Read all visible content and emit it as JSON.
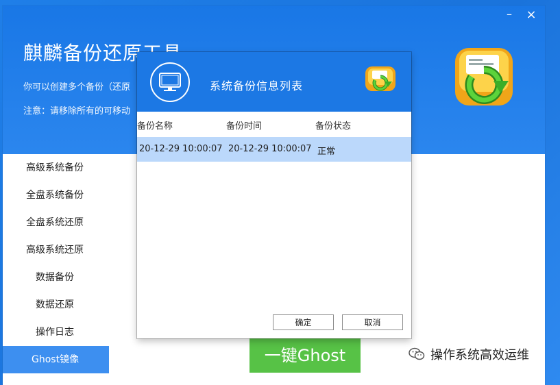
{
  "app": {
    "title": "麒麟备份还原工具",
    "desc1": "你可以创建多个备份（还原",
    "desc2": "注意：请移除所有的可移动",
    "minimize_glyph": "–",
    "close_glyph": "×"
  },
  "sidebar": {
    "items": [
      {
        "label": "高级系统备份"
      },
      {
        "label": "全盘系统备份"
      },
      {
        "label": "全盘系统还原"
      },
      {
        "label": "高级系统还原"
      },
      {
        "label": "数据备份"
      },
      {
        "label": "数据还原"
      },
      {
        "label": "操作日志"
      },
      {
        "label": "Ghost镜像"
      }
    ]
  },
  "main": {
    "ghost_button": "一键Ghost"
  },
  "dialog": {
    "title": "系统备份信息列表",
    "columns": [
      "备份名称",
      "备份时间",
      "备份状态"
    ],
    "rows": [
      {
        "name": "20-12-29 10:00:07",
        "time": "20-12-29 10:00:07",
        "status": "正常"
      }
    ],
    "ok": "确定",
    "cancel": "取消"
  },
  "watermark": {
    "text": "操作系统高效运维"
  },
  "colors": {
    "accent": "#1c78e4",
    "green": "#57c246",
    "selected_row": "#bbd8fb",
    "active_nav": "#3d8ff0"
  },
  "icons": [
    "minimize-icon",
    "close-icon",
    "monitor-icon",
    "backup-logo-icon",
    "wechat-icon"
  ]
}
